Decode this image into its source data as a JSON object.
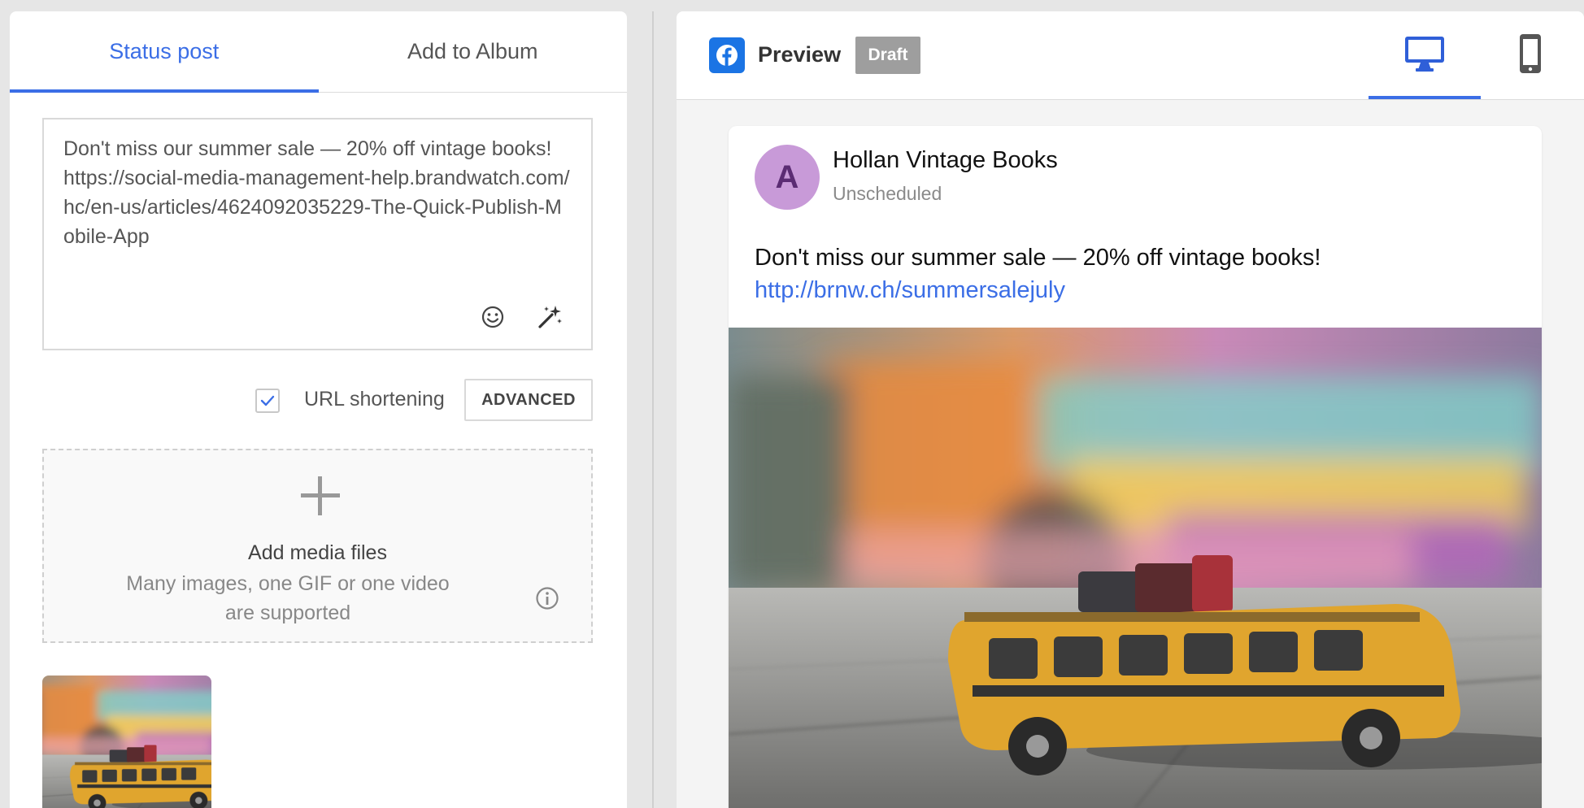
{
  "composer": {
    "tabs": [
      {
        "label": "Status post",
        "active": true
      },
      {
        "label": "Add to Album",
        "active": false
      }
    ],
    "post_text": "Don't miss our summer sale — 20% off vintage books!\nhttps://social-media-management-help.brandwatch.com/hc/en-us/articles/4624092035229-The-Quick-Publish-Mobile-App",
    "icons": {
      "emoji": "emoji-icon",
      "magic": "magic-wand-icon"
    },
    "url_shortening": {
      "label": "URL shortening",
      "checked": true
    },
    "advanced_label": "ADVANCED",
    "dropzone": {
      "title": "Add media files",
      "subtitle": "Many images, one GIF or one video are supported",
      "icon": "plus-icon",
      "info_icon": "info-icon"
    }
  },
  "preview": {
    "network_icon": "facebook-icon",
    "label": "Preview",
    "badge": "Draft",
    "devices": [
      {
        "icon": "desktop-icon",
        "active": true
      },
      {
        "icon": "mobile-icon",
        "active": false
      }
    ],
    "post": {
      "avatar_letter": "A",
      "page_name": "Hollan Vintage Books",
      "schedule": "Unscheduled",
      "text": "Don't miss our summer sale — 20% off vintage books!",
      "link": "http://brnw.ch/summersalejuly"
    }
  },
  "colors": {
    "accent": "#3b6ee6",
    "facebook": "#1b74e4",
    "draft_badge": "#9e9e9e",
    "avatar_bg": "#c89ad8",
    "avatar_fg": "#5b2c73",
    "van_yellow": "#e0a52e"
  }
}
